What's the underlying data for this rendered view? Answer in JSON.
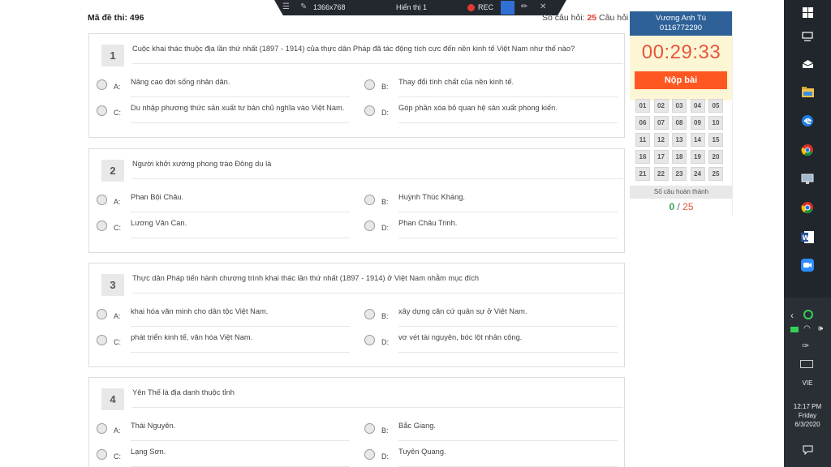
{
  "recorder": {
    "resolution": "1366x768",
    "display": "Hiển thị 1",
    "rec": "REC"
  },
  "header": {
    "exam_code": "Mã đề thi: 496",
    "count_prefix": "Số câu hỏi: ",
    "count": "25",
    "count_suffix": " Câu hỏi"
  },
  "questions": [
    {
      "number": "1",
      "text": "Cuộc khai thác thuộc địa lần thứ nhất (1897 - 1914) của thực dân Pháp đã tác động tích cực đến nền kinh tế Việt Nam như thế nào?",
      "options": [
        {
          "label": "A:",
          "text": "Nâng cao đời sống nhân dân."
        },
        {
          "label": "B:",
          "text": "Thay đổi tính chất của nền kinh tế."
        },
        {
          "label": "C:",
          "text": "Du nhập phương thức sản xuất tư bản chủ nghĩa vào Việt Nam."
        },
        {
          "label": "D:",
          "text": "Góp phần xóa bỏ quan hệ sản xuất phong kiến."
        }
      ]
    },
    {
      "number": "2",
      "text": "Người khởi xướng phong trào Đông du là",
      "options": [
        {
          "label": "A:",
          "text": "Phan Bội Châu."
        },
        {
          "label": "B:",
          "text": "Huỳnh Thúc Kháng."
        },
        {
          "label": "C:",
          "text": "Lương Văn Can."
        },
        {
          "label": "D:",
          "text": "Phan Châu Trinh."
        }
      ]
    },
    {
      "number": "3",
      "text": "Thực dân Pháp tiến hành chương trình khai thác lần thứ nhất (1897 - 1914) ở Việt Nam nhằm mục đích",
      "options": [
        {
          "label": "A:",
          "text": "khai hóa văn minh cho dân tộc Việt Nam."
        },
        {
          "label": "B:",
          "text": "xây dựng căn cứ quân sự ở Việt Nam."
        },
        {
          "label": "C:",
          "text": "phát triển kinh tế, văn hóa Việt Nam."
        },
        {
          "label": "D:",
          "text": "vơ vét tài nguyên, bóc lột nhân công."
        }
      ]
    },
    {
      "number": "4",
      "text": "Yên Thế là địa danh thuộc tỉnh",
      "options": [
        {
          "label": "A:",
          "text": "Thái Nguyên."
        },
        {
          "label": "B:",
          "text": "Bắc Giang."
        },
        {
          "label": "C:",
          "text": "Lạng Sơn."
        },
        {
          "label": "D:",
          "text": "Tuyên Quang."
        }
      ]
    }
  ],
  "panel": {
    "user_name": "Vương Anh Tú",
    "user_id": "0116772290",
    "timer": "00:29:33",
    "submit_label": "Nộp bài",
    "question_cells": [
      "01",
      "02",
      "03",
      "04",
      "05",
      "06",
      "07",
      "08",
      "09",
      "10",
      "11",
      "12",
      "13",
      "14",
      "15",
      "16",
      "17",
      "18",
      "19",
      "20",
      "21",
      "22",
      "23",
      "24",
      "25"
    ],
    "done_label": "Số câu hoàn thành",
    "done_count": "0",
    "separator": "/",
    "total": "25"
  },
  "taskbar": {
    "language": "VIE",
    "time": "12:17 PM",
    "day": "Friday",
    "date": "6/3/2020"
  }
}
